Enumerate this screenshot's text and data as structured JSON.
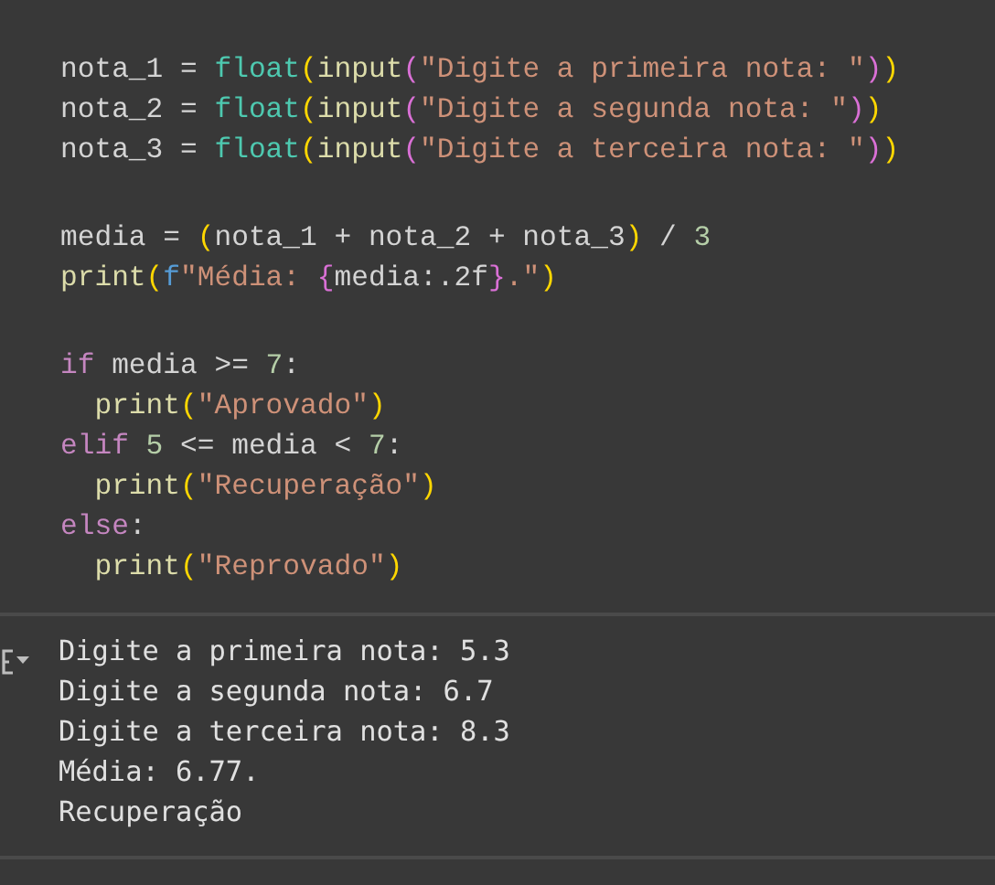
{
  "code_cell": {
    "blocks": [
      {
        "lines": [
          {
            "tokens": [
              {
                "text": "nota_1 = ",
                "kind": "plain"
              },
              {
                "text": "float",
                "kind": "type"
              },
              {
                "text": "(",
                "kind": "paren1"
              },
              {
                "text": "input",
                "kind": "func"
              },
              {
                "text": "(",
                "kind": "paren2"
              },
              {
                "text": "\"Digite a primeira nota: \"",
                "kind": "string"
              },
              {
                "text": ")",
                "kind": "paren2"
              },
              {
                "text": ")",
                "kind": "paren1"
              }
            ]
          },
          {
            "tokens": [
              {
                "text": "nota_2 = ",
                "kind": "plain"
              },
              {
                "text": "float",
                "kind": "type"
              },
              {
                "text": "(",
                "kind": "paren1"
              },
              {
                "text": "input",
                "kind": "func"
              },
              {
                "text": "(",
                "kind": "paren2"
              },
              {
                "text": "\"Digite a segunda nota: \"",
                "kind": "string"
              },
              {
                "text": ")",
                "kind": "paren2"
              },
              {
                "text": ")",
                "kind": "paren1"
              }
            ]
          },
          {
            "tokens": [
              {
                "text": "nota_3 = ",
                "kind": "plain"
              },
              {
                "text": "float",
                "kind": "type"
              },
              {
                "text": "(",
                "kind": "paren1"
              },
              {
                "text": "input",
                "kind": "func"
              },
              {
                "text": "(",
                "kind": "paren2"
              },
              {
                "text": "\"Digite a terceira nota: \"",
                "kind": "string"
              },
              {
                "text": ")",
                "kind": "paren2"
              },
              {
                "text": ")",
                "kind": "paren1"
              }
            ]
          }
        ]
      },
      {
        "lines": [
          {
            "tokens": [
              {
                "text": "media = ",
                "kind": "plain"
              },
              {
                "text": "(",
                "kind": "paren1"
              },
              {
                "text": "nota_1 + nota_2 + nota_3",
                "kind": "plain"
              },
              {
                "text": ")",
                "kind": "paren1"
              },
              {
                "text": " / ",
                "kind": "plain"
              },
              {
                "text": "3",
                "kind": "number"
              }
            ]
          },
          {
            "tokens": [
              {
                "text": "print",
                "kind": "func"
              },
              {
                "text": "(",
                "kind": "paren1"
              },
              {
                "text": "f",
                "kind": "prefix"
              },
              {
                "text": "\"Média: ",
                "kind": "string"
              },
              {
                "text": "{",
                "kind": "paren2"
              },
              {
                "text": "media:.2f",
                "kind": "plain"
              },
              {
                "text": "}",
                "kind": "paren2"
              },
              {
                "text": ".\"",
                "kind": "string"
              },
              {
                "text": ")",
                "kind": "paren1"
              }
            ]
          }
        ]
      },
      {
        "lines": [
          {
            "tokens": [
              {
                "text": "if",
                "kind": "keyword"
              },
              {
                "text": " media >= ",
                "kind": "plain"
              },
              {
                "text": "7",
                "kind": "number"
              },
              {
                "text": ":",
                "kind": "plain"
              }
            ]
          },
          {
            "tokens": [
              {
                "text": "  print",
                "kind": "func"
              },
              {
                "text": "(",
                "kind": "paren1"
              },
              {
                "text": "\"Aprovado\"",
                "kind": "string"
              },
              {
                "text": ")",
                "kind": "paren1"
              }
            ]
          },
          {
            "tokens": [
              {
                "text": "elif ",
                "kind": "keyword"
              },
              {
                "text": "5",
                "kind": "number"
              },
              {
                "text": " <= media < ",
                "kind": "plain"
              },
              {
                "text": "7",
                "kind": "number"
              },
              {
                "text": ":",
                "kind": "plain"
              }
            ]
          },
          {
            "tokens": [
              {
                "text": "  print",
                "kind": "func"
              },
              {
                "text": "(",
                "kind": "paren1"
              },
              {
                "text": "\"Recuperação\"",
                "kind": "string"
              },
              {
                "text": ")",
                "kind": "paren1"
              }
            ]
          },
          {
            "tokens": [
              {
                "text": "else",
                "kind": "keyword"
              },
              {
                "text": ":",
                "kind": "plain"
              }
            ]
          },
          {
            "tokens": [
              {
                "text": "  print",
                "kind": "func"
              },
              {
                "text": "(",
                "kind": "paren1"
              },
              {
                "text": "\"Reprovado\"",
                "kind": "string"
              },
              {
                "text": ")",
                "kind": "paren1"
              }
            ]
          }
        ]
      }
    ]
  },
  "output": {
    "lines": [
      "Digite a primeira nota: 5.3",
      "Digite a segunda nota: 6.7",
      "Digite a terceira nota: 8.3",
      "Média: 6.77.",
      "Recuperação"
    ]
  }
}
